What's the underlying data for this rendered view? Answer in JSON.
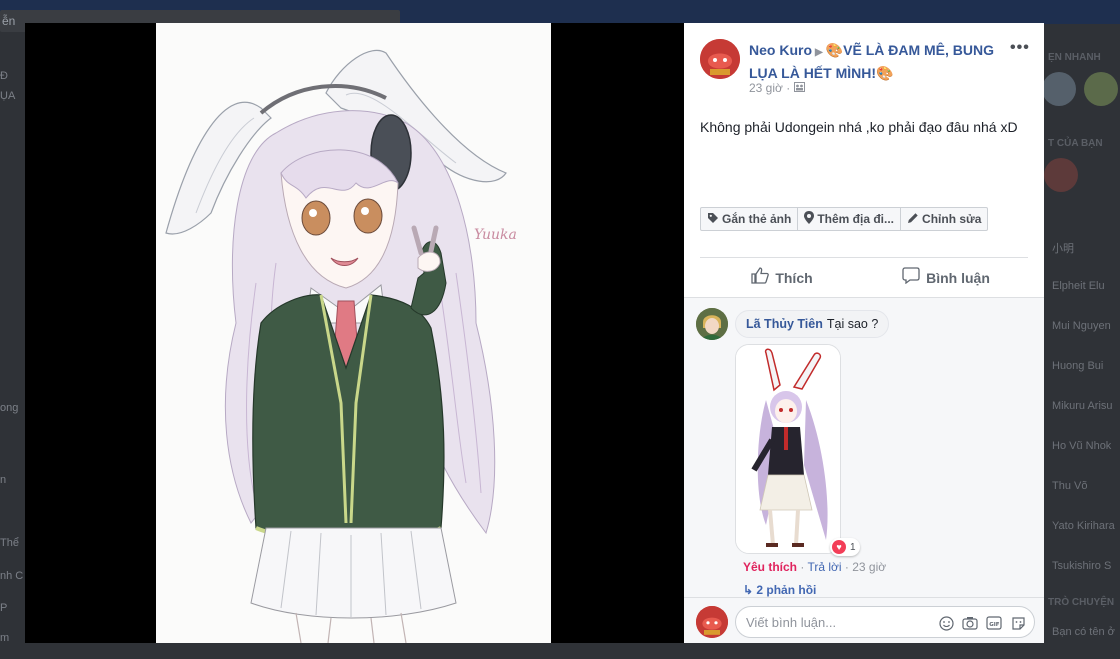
{
  "background": {
    "search_snippet": "ễn",
    "left_snippets": [
      "Đ",
      "ỤA",
      "ong",
      "n",
      "Thể",
      "nh C",
      "P",
      "m"
    ],
    "right_heading_1": "ẸN NHANH",
    "right_heading_2": "T CỦA BẠN",
    "right_heading_3": "TRÒ CHUYỆN",
    "right_contacts": [
      "小明",
      "Elpheit Elu",
      "Mui Nguyen",
      "Huong Bui",
      "Mikuru Arisu",
      "Ho Vũ Nhok",
      "Thu Võ",
      "Yato Kirihara",
      "Tsukishiro S",
      "Bạn có tên ở"
    ]
  },
  "post": {
    "poster_name": "Neo Kuro",
    "group_name": "🎨VẼ LÀ ĐAM MÊ, BUNG LỤA LÀ HẾT MÌNH!🎨",
    "time": "23 giờ",
    "privacy_icon": "group-icon",
    "more_label": "•••",
    "text": "Không phải Udongein nhá ,ko phải đạo đâu nhá xD",
    "signature": "Yuuka"
  },
  "tools": {
    "tag_label": "Gắn thẻ ảnh",
    "location_label": "Thêm địa đi...",
    "edit_label": "Chỉnh sửa"
  },
  "actions": {
    "like_label": "Thích",
    "comment_label": "Bình luận"
  },
  "comment": {
    "author": "Lã Thủy Tiên",
    "text": "Tại sao ?",
    "reaction_count": "1",
    "reaction_label": "Yêu thích",
    "reply_label": "Trả lời",
    "time": "23 giờ",
    "separator": " · ",
    "replies_label": "2 phản hồi"
  },
  "composer": {
    "placeholder": "Viết bình luận..."
  },
  "colors": {
    "link": "#365899",
    "love": "#f33e58",
    "viewer_bg": "#000000"
  }
}
